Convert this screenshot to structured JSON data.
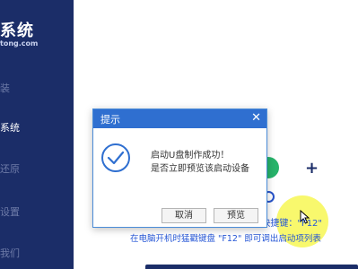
{
  "brand": {
    "title": "系统",
    "url": "tong.com"
  },
  "sidebar": {
    "items": [
      {
        "label": "装"
      },
      {
        "label": "系统"
      },
      {
        "label": "还原"
      },
      {
        "label": "设置"
      },
      {
        "label": "我们"
      }
    ]
  },
  "main": {
    "shortcut_hint": "u快捷键：\"F12\"",
    "hint": "在电脑开机时猛戳键盘 \"F12\" 即可调出启动项列表"
  },
  "dialog": {
    "title": "提示",
    "message_line1": "启动U盘制作成功！",
    "message_line2": "是否立即预览该启动设备",
    "cancel_label": "取消",
    "preview_label": "预览"
  },
  "colors": {
    "sidebar": "#1b2d68",
    "dialog_header": "#2f6fd0",
    "hint_text": "#2556d6",
    "status_green": "#27b36a"
  }
}
